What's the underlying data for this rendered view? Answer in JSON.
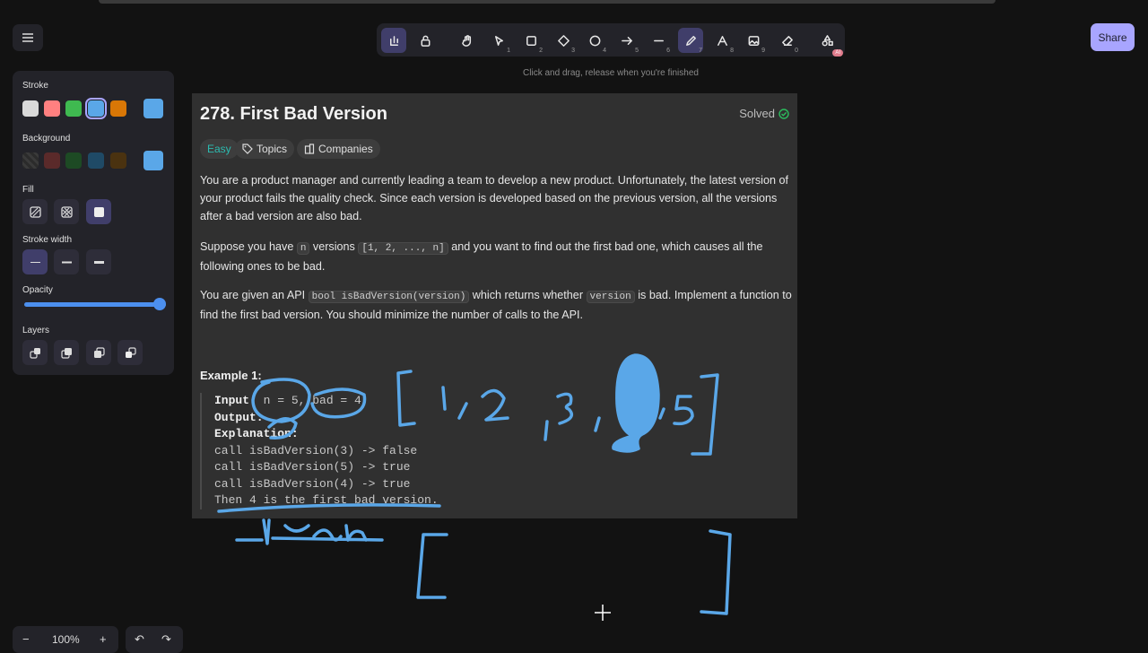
{
  "toolbar": {
    "hint": "Click and drag, release when you're finished",
    "tools": [
      {
        "icon": "lock-keep-icon",
        "key": ""
      },
      {
        "icon": "lock-icon",
        "key": ""
      },
      {
        "icon": "hand-icon",
        "key": ""
      },
      {
        "icon": "selection-icon",
        "key": "1"
      },
      {
        "icon": "rectangle-icon",
        "key": "2"
      },
      {
        "icon": "diamond-icon",
        "key": "3"
      },
      {
        "icon": "ellipse-icon",
        "key": "4"
      },
      {
        "icon": "arrow-icon",
        "key": "5"
      },
      {
        "icon": "line-icon",
        "key": "6"
      },
      {
        "icon": "pencil-icon",
        "key": "7"
      },
      {
        "icon": "text-icon",
        "key": "8"
      },
      {
        "icon": "image-icon",
        "key": "9"
      },
      {
        "icon": "eraser-icon",
        "key": "0"
      },
      {
        "icon": "more-tools-icon",
        "key": ""
      }
    ],
    "ai_badge": "AI"
  },
  "share_label": "Share",
  "panel": {
    "stroke_label": "Stroke",
    "stroke_colors": [
      "#d9d9d9",
      "#ff8080",
      "#3fb950",
      "#5aa7e8",
      "#d97706"
    ],
    "stroke_current": "#5aa7e8",
    "background_label": "Background",
    "background_colors": [
      "#2b2b2b",
      "#5a2a2a",
      "#1d4a24",
      "#1f4a66",
      "#4a3210"
    ],
    "background_current": "#5aa7e8",
    "fill_label": "Fill",
    "stroke_width_label": "Stroke width",
    "opacity_label": "Opacity",
    "opacity_value": 100,
    "layers_label": "Layers"
  },
  "problem": {
    "title": "278. First Bad Version",
    "status": "Solved",
    "tags": {
      "difficulty": "Easy",
      "topics": "Topics",
      "companies": "Companies"
    },
    "p1": "You are a product manager and currently leading a team to develop a new product. Unfortunately, the latest version of your product fails the quality check. Since each version is developed based on the previous version, all the versions after a bad version are also bad.",
    "p2_a": "Suppose you have ",
    "p2_code1": "n",
    "p2_b": " versions ",
    "p2_code2": "[1, 2, ..., n]",
    "p2_c": " and you want to find out the first bad one, which causes all the following ones to be bad.",
    "p3_a": "You are given an API ",
    "p3_code1": "bool isBadVersion(version)",
    "p3_b": " which returns whether ",
    "p3_code2": "version",
    "p3_c": " is bad. Implement a function to find the first bad version. You should minimize the number of calls to the API.",
    "example_title": "Example 1:",
    "input_label": "Input:",
    "input_value": " n = 5, bad = 4",
    "output_label": "Output:",
    "explanation_label": "Explanation:",
    "lines": [
      "call isBadVersion(3) -> false",
      "call isBadVersion(5) -> true",
      "call isBadVersion(4) -> true",
      "Then 4 is the first bad version."
    ]
  },
  "zoom": {
    "minus": "−",
    "value": "100%",
    "plus": "+"
  },
  "history": {
    "undo": "↶",
    "redo": "↷"
  }
}
